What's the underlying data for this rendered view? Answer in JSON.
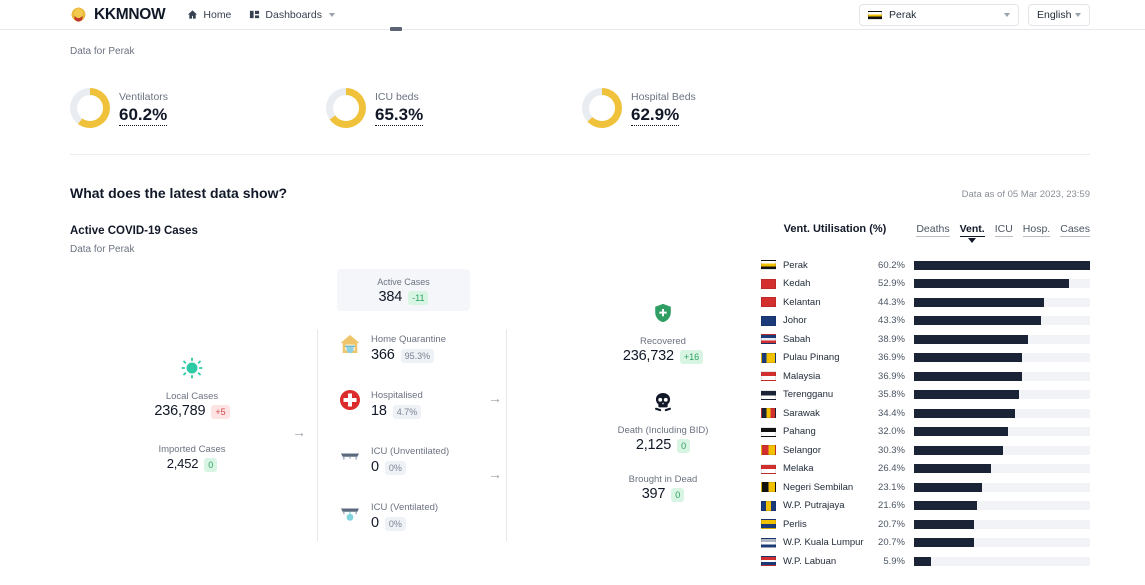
{
  "header": {
    "brand": "KKMNOW",
    "brand_crest_icon": "malaysia-crest-icon",
    "nav": [
      {
        "label": "Home",
        "icon": "home-icon"
      },
      {
        "label": "Dashboards",
        "icon": "grid-icon",
        "chevron": "chevron-down-icon"
      }
    ],
    "state_select": {
      "value": "Perak",
      "flag": "flag-perak",
      "chevron": "chevron-down-icon"
    },
    "language_select": {
      "value": "English",
      "chevron": "chevron-down-icon"
    }
  },
  "top": {
    "data_for": "Data for Perak"
  },
  "donuts": [
    {
      "label": "Ventilators",
      "value": "60.2%",
      "pct": 60.2,
      "color": "#f0c23c"
    },
    {
      "label": "ICU beds",
      "value": "65.3%",
      "pct": 65.3,
      "color": "#f0c23c"
    },
    {
      "label": "Hospital Beds",
      "value": "62.9%",
      "pct": 62.9,
      "color": "#f0c23c"
    }
  ],
  "section": {
    "title": "What does the latest data show?",
    "as_of": "Data as of 05 Mar 2023, 23:59",
    "subtitle": "Active COVID-19 Cases",
    "data_for": "Data for Perak"
  },
  "right_panel": {
    "title": "Vent. Utilisation (%)",
    "tabs": [
      {
        "label": "Deaths",
        "active": false
      },
      {
        "label": "Vent.",
        "active": true
      },
      {
        "label": "ICU",
        "active": false
      },
      {
        "label": "Hosp.",
        "active": false
      },
      {
        "label": "Cases",
        "active": false
      }
    ]
  },
  "flow": {
    "local_cases": {
      "icon": "virus-icon",
      "label": "Local Cases",
      "value": "236,789",
      "delta": "+5",
      "delta_tone": "red"
    },
    "imported_cases": {
      "label": "Imported Cases",
      "value": "2,452",
      "delta": "0",
      "delta_tone": "green"
    },
    "active_cases": {
      "label": "Active Cases",
      "value": "384",
      "delta": "-11",
      "delta_tone": "green"
    },
    "breakdown": [
      {
        "icon": "home-quarantine-icon",
        "label": "Home Quarantine",
        "value": "366",
        "share": "95.3%"
      },
      {
        "icon": "hospital-cross-icon",
        "label": "Hospitalised",
        "value": "18",
        "share": "4.7%"
      },
      {
        "icon": "icu-bed-icon",
        "label": "ICU (Unventilated)",
        "value": "0",
        "share": "0%"
      },
      {
        "icon": "icu-ventilator-icon",
        "label": "ICU (Ventilated)",
        "value": "0",
        "share": "0%"
      }
    ],
    "recovered": {
      "icon": "shield-plus-icon",
      "label": "Recovered",
      "value": "236,732",
      "delta": "+16",
      "delta_tone": "green"
    },
    "death": {
      "icon": "skull-icon",
      "label": "Death (Including BID)",
      "value": "2,125",
      "delta": "0",
      "delta_tone": "green"
    },
    "brought_in_dead": {
      "label": "Brought in Dead",
      "value": "397",
      "delta": "0",
      "delta_tone": "green"
    },
    "arrow_icon": "arrow-right-icon"
  },
  "chart_data": {
    "type": "bar",
    "title": "Vent. Utilisation (%)",
    "xlabel": "",
    "ylabel": "",
    "orientation": "horizontal",
    "grid": false,
    "xlim": [
      0,
      60.2
    ],
    "categories": [
      "Perak",
      "Kedah",
      "Kelantan",
      "Johor",
      "Sabah",
      "Pulau Pinang",
      "Malaysia",
      "Terengganu",
      "Sarawak",
      "Pahang",
      "Selangor",
      "Melaka",
      "Negeri Sembilan",
      "W.P. Putrajaya",
      "Perlis",
      "W.P. Kuala Lumpur",
      "W.P. Labuan"
    ],
    "values": [
      60.2,
      52.9,
      44.3,
      43.3,
      38.9,
      36.9,
      36.9,
      35.8,
      34.4,
      32.0,
      30.3,
      26.4,
      23.1,
      21.6,
      20.7,
      20.7,
      5.9
    ],
    "labels": [
      "60.2%",
      "52.9%",
      "44.3%",
      "43.3%",
      "38.9%",
      "36.9%",
      "36.9%",
      "35.8%",
      "34.4%",
      "32.0%",
      "30.3%",
      "26.4%",
      "23.1%",
      "21.6%",
      "20.7%",
      "20.7%",
      "5.9%"
    ],
    "bar_color": "#1b2436",
    "track_color": "#f1f3f7",
    "flags": [
      "linear-gradient(#ffffff 0 33%, #f2c200 33% 66%, #111111 66%)",
      "linear-gradient(90deg,#d32f2f 0 100%)",
      "linear-gradient(#d32f2f 0 100%)",
      "linear-gradient(#1a3a7a 0 100%)",
      "linear-gradient(#1a3a7a 0 40%, #e8eef7 40% 70%, #d32f2f 70%)",
      "linear-gradient(90deg,#1a3a7a 0 35%, #f2c200 35%)",
      "linear-gradient(#d32f2f 0 50%, #ffffff 50%)",
      "linear-gradient(#1b2436 0 55%, #ffffff 55%)",
      "linear-gradient(90deg,#1b2436 0 33%, #f2c200 33% 66%, #d32f2f 66%)",
      "linear-gradient(#111111 0 50%, #ffffff 50%)",
      "linear-gradient(90deg,#d32f2f 0 50%, #f2c200 50%)",
      "linear-gradient(#d32f2f 0 50%, #ffffff 50%)",
      "linear-gradient(90deg,#111111 0 50%, #f2c200 50%)",
      "linear-gradient(90deg,#1a3a7a 0 30%, #f2c200 30% 70%, #1a3a7a 70%)",
      "linear-gradient(#f2c200 0 50%, #1a3a7a 50%)",
      "linear-gradient(#b0b7c3 0 40%, #ffffff 40% 70%, #1a3a7a 70%)",
      "linear-gradient(#d32f2f 0 35%, #ffffff 35% 65%, #1a3a7a 65%)"
    ]
  }
}
